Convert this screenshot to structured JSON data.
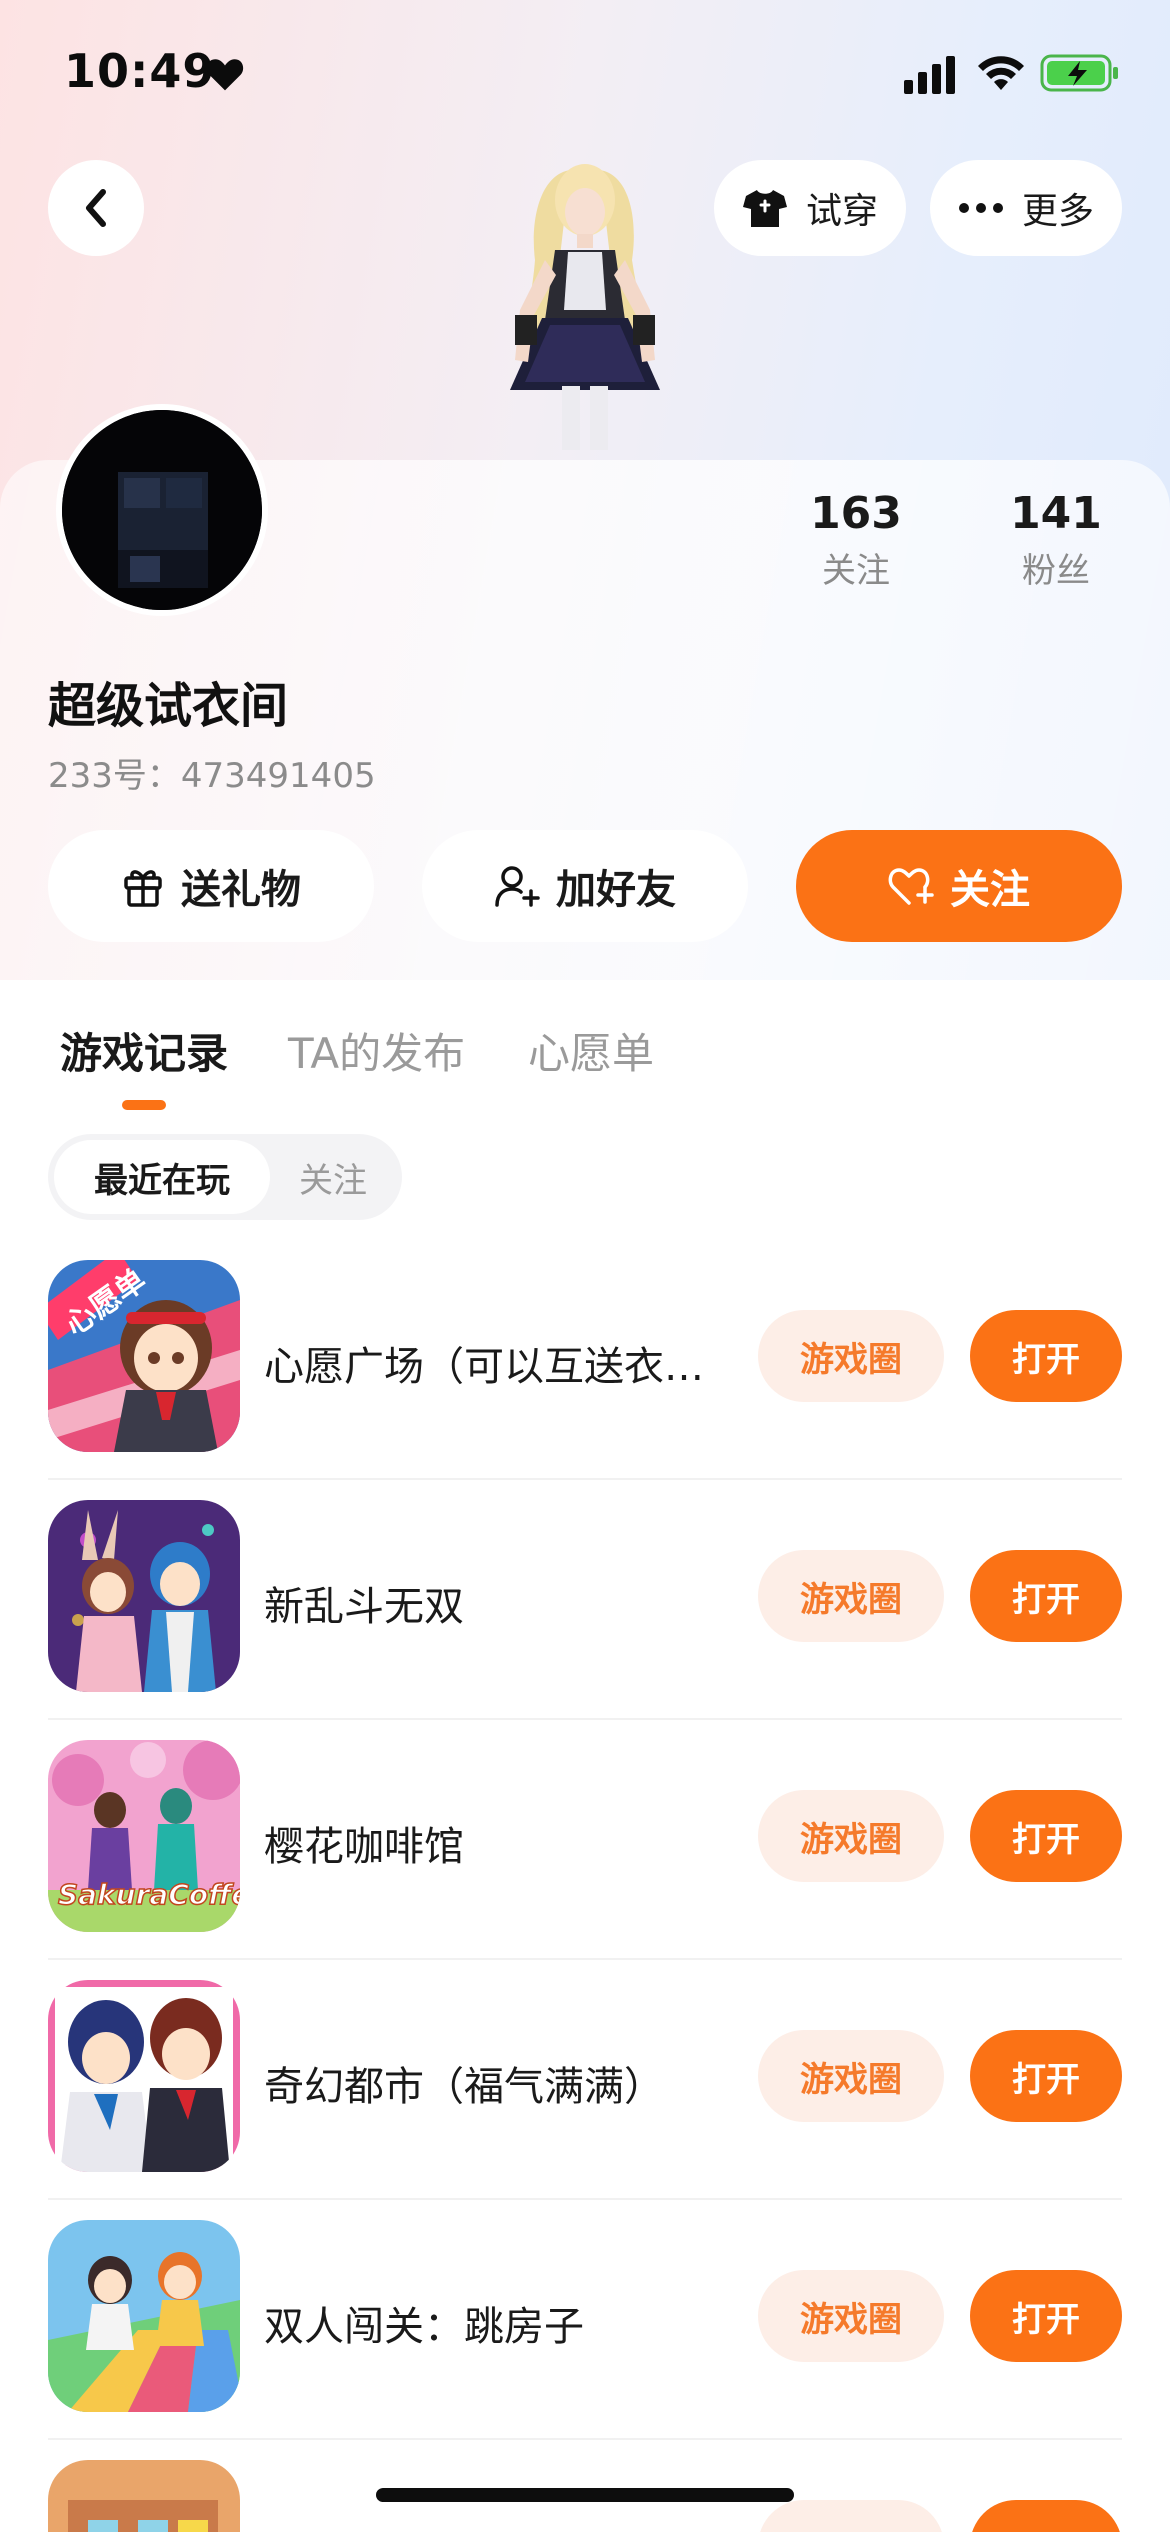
{
  "status_bar": {
    "time": "10:49"
  },
  "header": {
    "tryon_label": "试穿",
    "more_label": "更多"
  },
  "profile": {
    "name": "超级试衣间",
    "id_text": "233号：473491405",
    "following_count": "163",
    "following_label": "关注",
    "fans_count": "141",
    "fans_label": "粉丝"
  },
  "actions": {
    "gift_label": "送礼物",
    "add_friend_label": "加好友",
    "follow_label": "关注"
  },
  "tabs": [
    {
      "label": "游戏记录",
      "active": true
    },
    {
      "label": "TA的发布",
      "active": false
    },
    {
      "label": "心愿单",
      "active": false
    }
  ],
  "segments": [
    {
      "label": "最近在玩",
      "active": true
    },
    {
      "label": "关注",
      "active": false
    }
  ],
  "games": [
    {
      "title": "心愿广场（可以互送衣服）",
      "icon_badge": "心愿单",
      "circle_label": "游戏圈",
      "open_label": "打开"
    },
    {
      "title": "新乱斗无双",
      "circle_label": "游戏圈",
      "open_label": "打开"
    },
    {
      "title": "樱花咖啡馆",
      "icon_badge": "SakuraCoffee",
      "circle_label": "游戏圈",
      "open_label": "打开"
    },
    {
      "title": "奇幻都市（福气满满）",
      "circle_label": "游戏圈",
      "open_label": "打开"
    },
    {
      "title": "双人闯关：跳房子",
      "circle_label": "游戏圈",
      "open_label": "打开"
    }
  ],
  "colors": {
    "accent": "#fb7215",
    "accent_soft": "#fdeee7",
    "muted_text": "#8b8b8b"
  }
}
